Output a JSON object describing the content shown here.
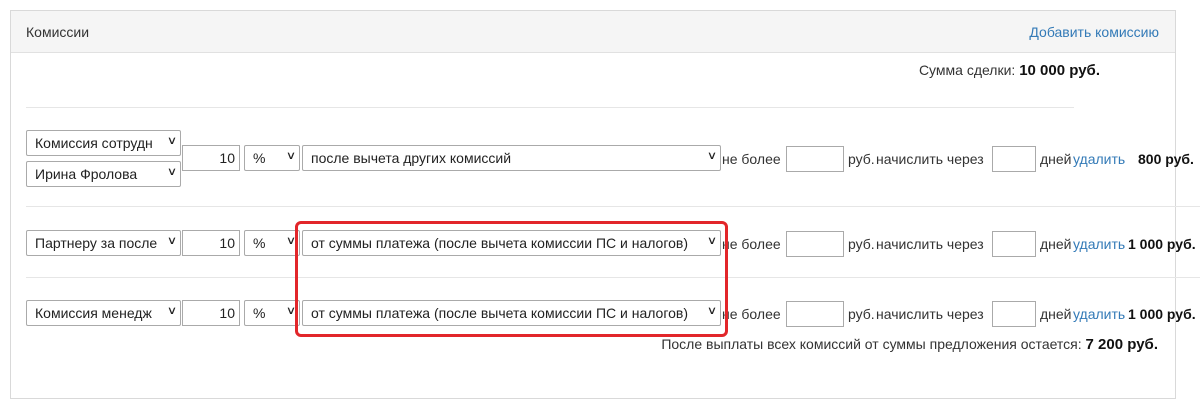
{
  "panel": {
    "title": "Комиссии",
    "add_commission": "Добавить комиссию"
  },
  "deal_sum": {
    "label": "Сумма сделки:",
    "value": "10 000 руб."
  },
  "commissions": [
    {
      "type": "Комиссия сотрудн",
      "employee": "Ирина Фролова",
      "amount": "10",
      "unit": "%",
      "base": "после вычета других комиссий",
      "no_more_label": "не более",
      "no_more_value": "",
      "rub_label": "руб.",
      "accrue_label": "начислить через",
      "days_value": "",
      "days_label": "дней",
      "delete_label": "удалить",
      "result": "800 руб."
    },
    {
      "type": "Партнеру за после",
      "amount": "10",
      "unit": "%",
      "base": "от суммы платежа (после вычета комиссии ПС и налогов)",
      "no_more_label": "не более",
      "no_more_value": "",
      "rub_label": "руб.",
      "accrue_label": "начислить через",
      "days_value": "",
      "days_label": "дней",
      "delete_label": "удалить",
      "result": "1 000 руб."
    },
    {
      "type": "Комиссия менедж",
      "amount": "10",
      "unit": "%",
      "base": "от суммы платежа (после вычета комиссии ПС и налогов)",
      "no_more_label": "не более",
      "no_more_value": "",
      "rub_label": "руб.",
      "accrue_label": "начислить через",
      "days_value": "",
      "days_label": "дней",
      "delete_label": "удалить",
      "result": "1 000 руб."
    }
  ],
  "remainder": {
    "label": "После выплаты всех комиссий от суммы предложения остается:",
    "value": "7 200 руб."
  },
  "colors": {
    "link": "#337ab7",
    "highlight": "#e2262a",
    "header_bg": "#f5f5f5"
  },
  "icons": {
    "select_arrow": "chevron-down-icon"
  }
}
